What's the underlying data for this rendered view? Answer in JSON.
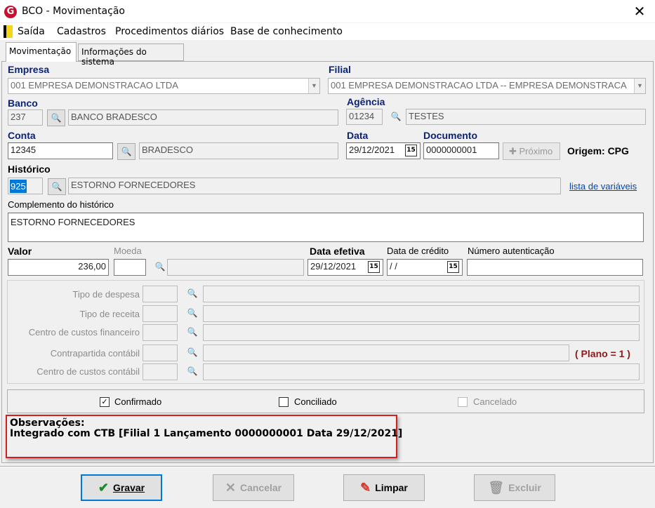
{
  "window": {
    "title": "BCO - Movimentação",
    "close": "✕",
    "app_icon": "G"
  },
  "menu": [
    "Saída",
    "Cadastros",
    "Procedimentos diários",
    "Base de conhecimento"
  ],
  "tabs": [
    "Movimentação",
    "Informações do sistema"
  ],
  "form": {
    "empresa_label": "Empresa",
    "empresa_value": "001 EMPRESA DEMONSTRACAO LTDA",
    "filial_label": "Filial",
    "filial_value": "001 EMPRESA DEMONSTRACAO LTDA -- EMPRESA DEMONSTRACA",
    "banco_label": "Banco",
    "banco_code": "237",
    "banco_name": "BANCO BRADESCO",
    "agencia_label": "Agência",
    "agencia_code": "01234",
    "agencia_name": "TESTES",
    "conta_label": "Conta",
    "conta_code": "12345",
    "conta_name": "BRADESCO",
    "data_label": "Data",
    "data_value": "29/12/2021",
    "documento_label": "Documento",
    "documento_value": "0000000001",
    "proximo_label": "Próximo",
    "origem_label": "Origem: CPG",
    "historico_label": "Histórico",
    "historico_code": "925",
    "historico_name": "ESTORNO FORNECEDORES",
    "variaveis_link": "lista de variáveis",
    "complemento_label": "Complemento do histórico",
    "complemento_value": "ESTORNO FORNECEDORES",
    "valor_label": "Valor",
    "valor_value": "236,00",
    "moeda_label": "Moeda",
    "data_efetiva_label": "Data efetiva",
    "data_efetiva_value": "29/12/2021",
    "data_credito_label": "Data de crédito",
    "data_credito_value": " /  /",
    "numero_autenticacao_label": "Número autenticação",
    "cal_icon_text": "15"
  },
  "group": {
    "rows": [
      "Tipo de despesa",
      "Tipo de receita",
      "Centro de custos financeiro",
      "Contrapartida contábil",
      "Centro de custos contábil"
    ],
    "plano": "( Plano = 1 )"
  },
  "checks": {
    "confirmado": "Confirmado",
    "conciliado": "Conciliado",
    "cancelado": "Cancelado",
    "confirmado_checked": true,
    "conciliado_checked": false,
    "cancelado_checked": false
  },
  "observacoes": {
    "title": "Observações:",
    "text": "Integrado com CTB [Filial 1 Lançamento 0000000001 Data 29/12/2021]"
  },
  "buttons": {
    "gravar": "Gravar",
    "cancelar": "Cancelar",
    "limpar": "Limpar",
    "excluir": "Excluir"
  },
  "icons": {
    "binoculars": "binoculars-icon",
    "calendar": "calendar-icon",
    "check": "checkmark-icon",
    "cancel_x": "cancel-x-icon",
    "eraser": "eraser-icon",
    "trash": "trash-icon"
  },
  "colors": {
    "label_blue": "#0a2378",
    "highlight": "#d21f1f",
    "link": "#0645ad",
    "plano": "#8b1a1a",
    "accent": "#0078d7"
  }
}
